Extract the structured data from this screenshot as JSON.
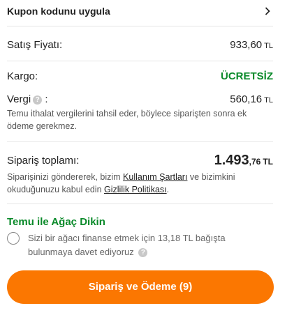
{
  "coupon": {
    "label": "Kupon kodunu uygula",
    "icon": "chevron-right-icon"
  },
  "summary": {
    "sale_price": {
      "label": "Satış Fiyatı:",
      "value": "933,60",
      "currency": "TL"
    },
    "shipping": {
      "label": "Kargo:",
      "value": "ÜCRETSİZ"
    },
    "tax": {
      "label": "Vergi",
      "separator": ":",
      "help_icon": "question-icon",
      "value": "560,16",
      "currency": "TL",
      "note": "Temu ithalat vergilerini tahsil eder, böylece siparişten sonra ek ödeme gerekmez."
    },
    "total": {
      "label": "Sipariş toplamı:",
      "integer": "1.493",
      "decimal": ",76",
      "currency": "TL"
    },
    "terms": {
      "before": "Siparişinizi göndererek, bizim ",
      "terms_link": "Kullanım Şartları",
      "middle": " ve bizimkini okuduğunuzu kabul edin ",
      "privacy_link": "Gizlilik Politikası",
      "after": "."
    }
  },
  "tree": {
    "title": "Temu ile Ağaç Dikin",
    "text": "Sizi bir ağacı finanse etmek için 13,18 TL bağışta bulunmaya davet ediyoruz",
    "help_icon": "question-icon",
    "checked": false
  },
  "cta": {
    "label": "Sipariş ve Ödeme (9)",
    "color": "#fb7701"
  },
  "colors": {
    "green": "#0a8a2a",
    "divider": "#e6e6e6"
  }
}
